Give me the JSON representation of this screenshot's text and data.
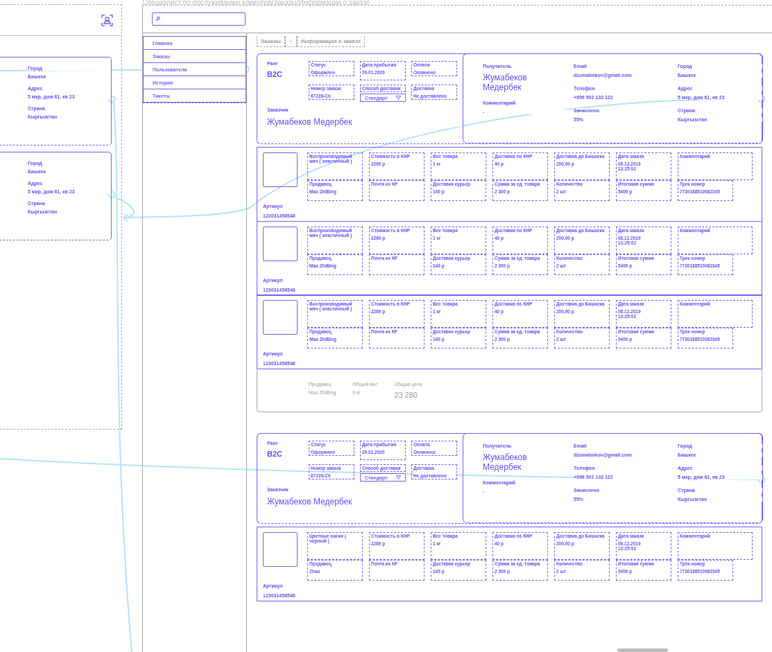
{
  "page_title": "Специалист по обслуживанию клиентов/Заказы/Информация о заказе",
  "left_panel": {
    "cards": [
      {
        "fields": [
          {
            "label": "Город",
            "value": "Бишкек"
          },
          {
            "label": "Адрес",
            "value": "5 мкр, дом 61, кв 23"
          },
          {
            "label": "Страна",
            "value": "Кыргызстан"
          }
        ]
      },
      {
        "fields": [
          {
            "label": "Город",
            "value": "Бишкек"
          },
          {
            "label": "Адрес",
            "value": "5 мкр, дом 61, кв 23"
          },
          {
            "label": "Страна",
            "value": "Кыргызстан"
          }
        ]
      }
    ]
  },
  "sidebar": {
    "items": [
      {
        "label": "Главная",
        "selected": false
      },
      {
        "label": "Заказы",
        "selected": false
      },
      {
        "label": "Пользователи",
        "selected": false
      },
      {
        "label": "История",
        "selected": false
      },
      {
        "label": "Тикеты",
        "selected": false
      }
    ]
  },
  "breadcrumbs": [
    "Заказы",
    "○",
    "Информация о заказе"
  ],
  "orders": [
    {
      "rank": {
        "label": "Ранг",
        "value": "B2C"
      },
      "fields": [
        {
          "kind": "field",
          "label": "Статус",
          "value": "Оформлен"
        },
        {
          "kind": "tall",
          "label": "Дата прибытия",
          "value": "29.01.2020"
        },
        {
          "kind": "field",
          "label": "Оплата",
          "value": "Оплачено"
        },
        {
          "kind": "field",
          "label": "Номер заказа",
          "value": "67239-Ch"
        },
        {
          "kind": "select",
          "label": "Способ доставки",
          "value": "Стандарт"
        },
        {
          "kind": "field",
          "label": "Доставка",
          "value": "Не доставлено"
        }
      ],
      "customer": {
        "label": "Заказчик",
        "value": "Жумабеков Медербек"
      },
      "recipient": {
        "columns": [
          [
            {
              "kind": "large",
              "label": "Получатель",
              "value": "Жумабеков Медербек"
            },
            {
              "kind": "plain",
              "label": "Комментарий",
              "value": "-"
            }
          ],
          [
            {
              "kind": "plain",
              "label": "Email",
              "value": "dzumabekov@gmail.com"
            },
            {
              "kind": "plain",
              "label": "Телефон",
              "value": "+996 502 133 122"
            },
            {
              "kind": "plain",
              "label": "Зачислено",
              "value": "55%"
            }
          ],
          [
            {
              "kind": "plain",
              "label": "Город",
              "value": "Бишкек"
            },
            {
              "kind": "plain",
              "label": "Адрес",
              "value": "5 мкр, дом 61, кв 23"
            },
            {
              "kind": "plain",
              "label": "Страна",
              "value": "Кыргызстан"
            }
          ]
        ]
      },
      "items": [
        {
          "name": "Воспроизводимый мяч ( эластичный )",
          "article": {
            "label": "Артикул",
            "value": "123031456548"
          },
          "fields": [
            {
              "kind": "field",
              "label": "Стоимость в КНР",
              "value": "2260 р"
            },
            {
              "kind": "field",
              "label": "Вес товара",
              "value": "1 кг"
            },
            {
              "kind": "field",
              "label": "Доставка по КНР",
              "value": "40 р"
            },
            {
              "kind": "field",
              "label": "Доставка до Бишкека",
              "value": "200,00 р"
            },
            {
              "kind": "tall",
              "label": "Дата заказа",
              "value": "08.12.2019\n13:25:02"
            },
            {
              "kind": "comment",
              "label": "Комментарий"
            },
            {
              "kind": "field",
              "label": "Продавец",
              "value": "Mao ZhiBing"
            },
            {
              "kind": "field",
              "label": "Почта из КР"
            },
            {
              "kind": "field",
              "label": "Доставка курьер",
              "value": "140 р"
            },
            {
              "kind": "field",
              "label": "Сумма за ед. товара",
              "value": "2 300 р"
            },
            {
              "kind": "field",
              "label": "Количество",
              "value": "2 шт"
            },
            {
              "kind": "field",
              "label": "Итоговая сумма",
              "value": "5400 р"
            },
            {
              "kind": "field",
              "label": "Трек номер",
              "value": "7730188510082345"
            }
          ]
        },
        {
          "name": "Воспроизводимый мяч ( эластичный )",
          "article": {
            "label": "Артикул",
            "value": "123031456548"
          },
          "fields": [
            {
              "kind": "field",
              "label": "Стоимость в КНР",
              "value": "2260 р"
            },
            {
              "kind": "field",
              "label": "Вес товара",
              "value": "1 кг"
            },
            {
              "kind": "field",
              "label": "Доставка по КНР",
              "value": "40 р"
            },
            {
              "kind": "field",
              "label": "Доставка до Бишкека",
              "value": "200,00 р"
            },
            {
              "kind": "tall",
              "label": "Дата заказа",
              "value": "08.12.2019\n13:25:02"
            },
            {
              "kind": "comment",
              "label": "Комментарий"
            },
            {
              "kind": "field",
              "label": "Продавец",
              "value": "Mao ZhiBing"
            },
            {
              "kind": "field",
              "label": "Почта из КР"
            },
            {
              "kind": "field",
              "label": "Доставка курьер",
              "value": "140 р"
            },
            {
              "kind": "field",
              "label": "Сумма за ед. товара",
              "value": "2 300 р"
            },
            {
              "kind": "field",
              "label": "Количество",
              "value": "2 шт"
            },
            {
              "kind": "field",
              "label": "Итоговая сумма",
              "value": "5400 р"
            },
            {
              "kind": "field",
              "label": "Трек номер",
              "value": "7730188510082345"
            }
          ]
        },
        {
          "name": "Воспроизводимый мяч ( эластичный )",
          "article": {
            "label": "Артикул",
            "value": "123031456548"
          },
          "fields": [
            {
              "kind": "field",
              "label": "Стоимость в КНР",
              "value": "2260 р"
            },
            {
              "kind": "field",
              "label": "Вес товара",
              "value": "1 кг"
            },
            {
              "kind": "field",
              "label": "Доставка по КНР",
              "value": "40 р"
            },
            {
              "kind": "field",
              "label": "Доставка до Бишкека",
              "value": "200,00 р"
            },
            {
              "kind": "tall",
              "label": "Дата заказа",
              "value": "08.12.2019\n13:25:02"
            },
            {
              "kind": "comment",
              "label": "Комментарий"
            },
            {
              "kind": "field",
              "label": "Продавец",
              "value": "Mao ZhiBing"
            },
            {
              "kind": "field",
              "label": "Почта из КР"
            },
            {
              "kind": "field",
              "label": "Доставка курьер",
              "value": "140 р"
            },
            {
              "kind": "field",
              "label": "Сумма за ед. товара",
              "value": "2 300 р"
            },
            {
              "kind": "field",
              "label": "Количество",
              "value": "2 шт"
            },
            {
              "kind": "field",
              "label": "Итоговая сумма",
              "value": "5400 р"
            },
            {
              "kind": "field",
              "label": "Трек номер",
              "value": "7730188510082345"
            }
          ]
        }
      ],
      "summary": {
        "fields": [
          {
            "kind": "plain",
            "label": "Продавец",
            "value": "Mao ZhiBing"
          },
          {
            "kind": "plain",
            "label": "Общий вес",
            "value": "9 кг"
          },
          {
            "kind": "large",
            "label": "Общая цена",
            "value": "23 280"
          }
        ]
      }
    },
    {
      "rank": {
        "label": "Ранг",
        "value": "B2C"
      },
      "fields": [
        {
          "kind": "field",
          "label": "Статус",
          "value": "Оформлен"
        },
        {
          "kind": "tall",
          "label": "Дата прибытия",
          "value": "29.01.2020"
        },
        {
          "kind": "field",
          "label": "Оплата",
          "value": "Оплачено"
        },
        {
          "kind": "field",
          "label": "Номер заказа",
          "value": "67239-Ch"
        },
        {
          "kind": "select",
          "label": "Способ доставки",
          "value": "Стандарт"
        },
        {
          "kind": "field",
          "label": "Доставка",
          "value": "Не доставлено"
        }
      ],
      "customer": {
        "label": "Заказчик",
        "value": "Жумабеков Медербек"
      },
      "recipient": {
        "columns": [
          [
            {
              "kind": "large",
              "label": "Получатель",
              "value": "Жумабеков Медербек"
            },
            {
              "kind": "plain",
              "label": "Комментарий",
              "value": "-"
            }
          ],
          [
            {
              "kind": "plain",
              "label": "Email",
              "value": "dzumabekov@gmail.com"
            },
            {
              "kind": "plain",
              "label": "Телефон",
              "value": "+996 502 133 122"
            },
            {
              "kind": "plain",
              "label": "Зачислено",
              "value": "55%"
            }
          ],
          [
            {
              "kind": "plain",
              "label": "Город",
              "value": "Бишкек"
            },
            {
              "kind": "plain",
              "label": "Адрес",
              "value": "5 мкр, дом 61, кв 23"
            },
            {
              "kind": "plain",
              "label": "Страна",
              "value": "Кыргызстан"
            }
          ]
        ]
      },
      "items": [
        {
          "name": "Цветные носки ( черный )",
          "article": {
            "label": "Артикул",
            "value": "123031456548"
          },
          "fields": [
            {
              "kind": "field",
              "label": "Стоимость в КНР",
              "value": "2260 р"
            },
            {
              "kind": "field",
              "label": "Вес товара",
              "value": "1 кг"
            },
            {
              "kind": "field",
              "label": "Доставка по КНР",
              "value": "40 р"
            },
            {
              "kind": "field",
              "label": "Доставка до Бишкека",
              "value": "200,00 р"
            },
            {
              "kind": "tall",
              "label": "Дата заказа",
              "value": "08.12.2019\n13:25:02"
            },
            {
              "kind": "comment",
              "label": "Комментарий"
            },
            {
              "kind": "field",
              "label": "Продавец",
              "value": "Zhao"
            },
            {
              "kind": "field",
              "label": "Почта из КР"
            },
            {
              "kind": "field",
              "label": "Доставка курьер",
              "value": "140 р"
            },
            {
              "kind": "field",
              "label": "Сумма за ед. товара",
              "value": "2 300 р"
            },
            {
              "kind": "field",
              "label": "Количество",
              "value": "2 шт"
            },
            {
              "kind": "field",
              "label": "Итоговая сумма",
              "value": "5400 р"
            },
            {
              "kind": "field",
              "label": "Трек номер",
              "value": "7730188510082345"
            }
          ]
        }
      ]
    }
  ]
}
